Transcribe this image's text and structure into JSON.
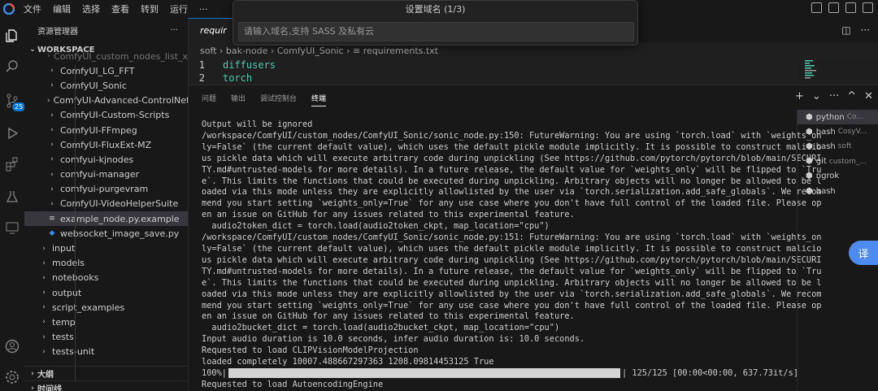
{
  "menu": [
    "文件",
    "编辑",
    "选择",
    "查看",
    "转到",
    "运行",
    "···"
  ],
  "palette": {
    "title": "设置域名 (1/3)",
    "placeholder": "请输入域名,支持 SASS 及私有云"
  },
  "activity": {
    "scm_badge": "25"
  },
  "sidebar": {
    "title": "资源管理器",
    "more": "···",
    "workspace": "WORKSPACE",
    "items": [
      {
        "label": "ComfyUI_custom_nodes_list_x",
        "type": "folder"
      },
      {
        "label": "ComfyUI_LG_FFT",
        "type": "folder"
      },
      {
        "label": "ComfyUI_Sonic",
        "type": "folder"
      },
      {
        "label": "ComfyUI-Advanced-ControlNet",
        "type": "folder"
      },
      {
        "label": "ComfyUI-Custom-Scripts",
        "type": "folder"
      },
      {
        "label": "ComfyUI-FFmpeg",
        "type": "folder"
      },
      {
        "label": "ComfyUI-FluxExt-MZ",
        "type": "folder"
      },
      {
        "label": "comfyui-kjnodes",
        "type": "folder"
      },
      {
        "label": "comfyui-manager",
        "type": "folder"
      },
      {
        "label": "comfyui-purgevram",
        "type": "folder"
      },
      {
        "label": "ComfyUI-VideoHelperSuite",
        "type": "folder"
      },
      {
        "label": "example_node.py.example",
        "type": "file"
      },
      {
        "label": "websocket_image_save.py",
        "type": "file"
      },
      {
        "label": "input",
        "type": "root"
      },
      {
        "label": "models",
        "type": "root"
      },
      {
        "label": "notebooks",
        "type": "root"
      },
      {
        "label": "output",
        "type": "root"
      },
      {
        "label": "script_examples",
        "type": "root"
      },
      {
        "label": "temp",
        "type": "root"
      },
      {
        "label": "tests",
        "type": "root"
      },
      {
        "label": "tests-unit",
        "type": "root"
      }
    ],
    "outline": "大纲",
    "timeline": "时间线"
  },
  "editor": {
    "tab_label": "requir",
    "breadcrumb": "soft › bak-node › ComfyUI_Sonic › ≡ requirements.txt",
    "lines": [
      {
        "num": "1",
        "text": "diffusers"
      },
      {
        "num": "2",
        "text": "torch"
      }
    ]
  },
  "panel": {
    "tabs": [
      "问题",
      "输出",
      "调试控制台",
      "终端"
    ],
    "active_tab": "终端",
    "terminal_lines": [
      "Output will be ignored",
      "/workspace/ComfyUI/custom_nodes/ComfyUI_Sonic/sonic_node.py:150: FutureWarning: You are using `torch.load` with `weights_on",
      "ly=False` (the current default value), which uses the default pickle module implicitly. It is possible to construct malicio",
      "us pickle data which will execute arbitrary code during unpickling (See https://github.com/pytorch/pytorch/blob/main/SECURI",
      "TY.md#untrusted-models for more details). In a future release, the default value for `weights_only` will be flipped to `Tru",
      "e`. This limits the functions that could be executed during unpickling. Arbitrary objects will no longer be allowed to be l",
      "oaded via this mode unless they are explicitly allowlisted by the user via `torch.serialization.add_safe_globals`. We recom",
      "mend you start setting `weights_only=True` for any use case where you don't have full control of the loaded file. Please op",
      "en an issue on GitHub for any issues related to this experimental feature.",
      "  audio2token_dict = torch.load(audio2token_ckpt, map_location=\"cpu\")",
      "/workspace/ComfyUI/custom_nodes/ComfyUI_Sonic/sonic_node.py:151: FutureWarning: You are using `torch.load` with `weights_on",
      "ly=False` (the current default value), which uses the default pickle module implicitly. It is possible to construct malicio",
      "us pickle data which will execute arbitrary code during unpickling (See https://github.com/pytorch/pytorch/blob/main/SECURI",
      "TY.md#untrusted-models for more details). In a future release, the default value for `weights_only` will be flipped to `Tru",
      "e`. This limits the functions that could be executed during unpickling. Arbitrary objects will no longer be allowed to be l",
      "oaded via this mode unless they are explicitly allowlisted by the user via `torch.serialization.add_safe_globals`. We recom",
      "mend you start setting `weights_only=True` for any use case where you don't have full control of the loaded file. Please op",
      "en an issue on GitHub for any issues related to this experimental feature.",
      "  audio2bucket_dict = torch.load(audio2bucket_ckpt, map_location=\"cpu\")",
      "Input audio duration is 10.0 seconds, infer audio duration is: 10.0 seconds.",
      "Requested to load CLIPVisionModelProjection",
      "loaded completely 10007.488667297363 1208.09814453125 True"
    ],
    "progress": {
      "prefix": "100%|",
      "suffix": "| 125/125 [00:00<00:00, 637.73it/s]",
      "fraction": 1.0
    },
    "last_line": "Requested to load AutoencodingEngine",
    "terminals": [
      {
        "name": "python",
        "sub": "Co..."
      },
      {
        "name": "bash",
        "sub": "CosyV..."
      },
      {
        "name": "bash",
        "sub": "soft"
      },
      {
        "name": "git",
        "sub": "custom_..."
      },
      {
        "name": "ngrok",
        "sub": ""
      },
      {
        "name": "bash",
        "sub": ""
      }
    ]
  },
  "translate_label": "译"
}
